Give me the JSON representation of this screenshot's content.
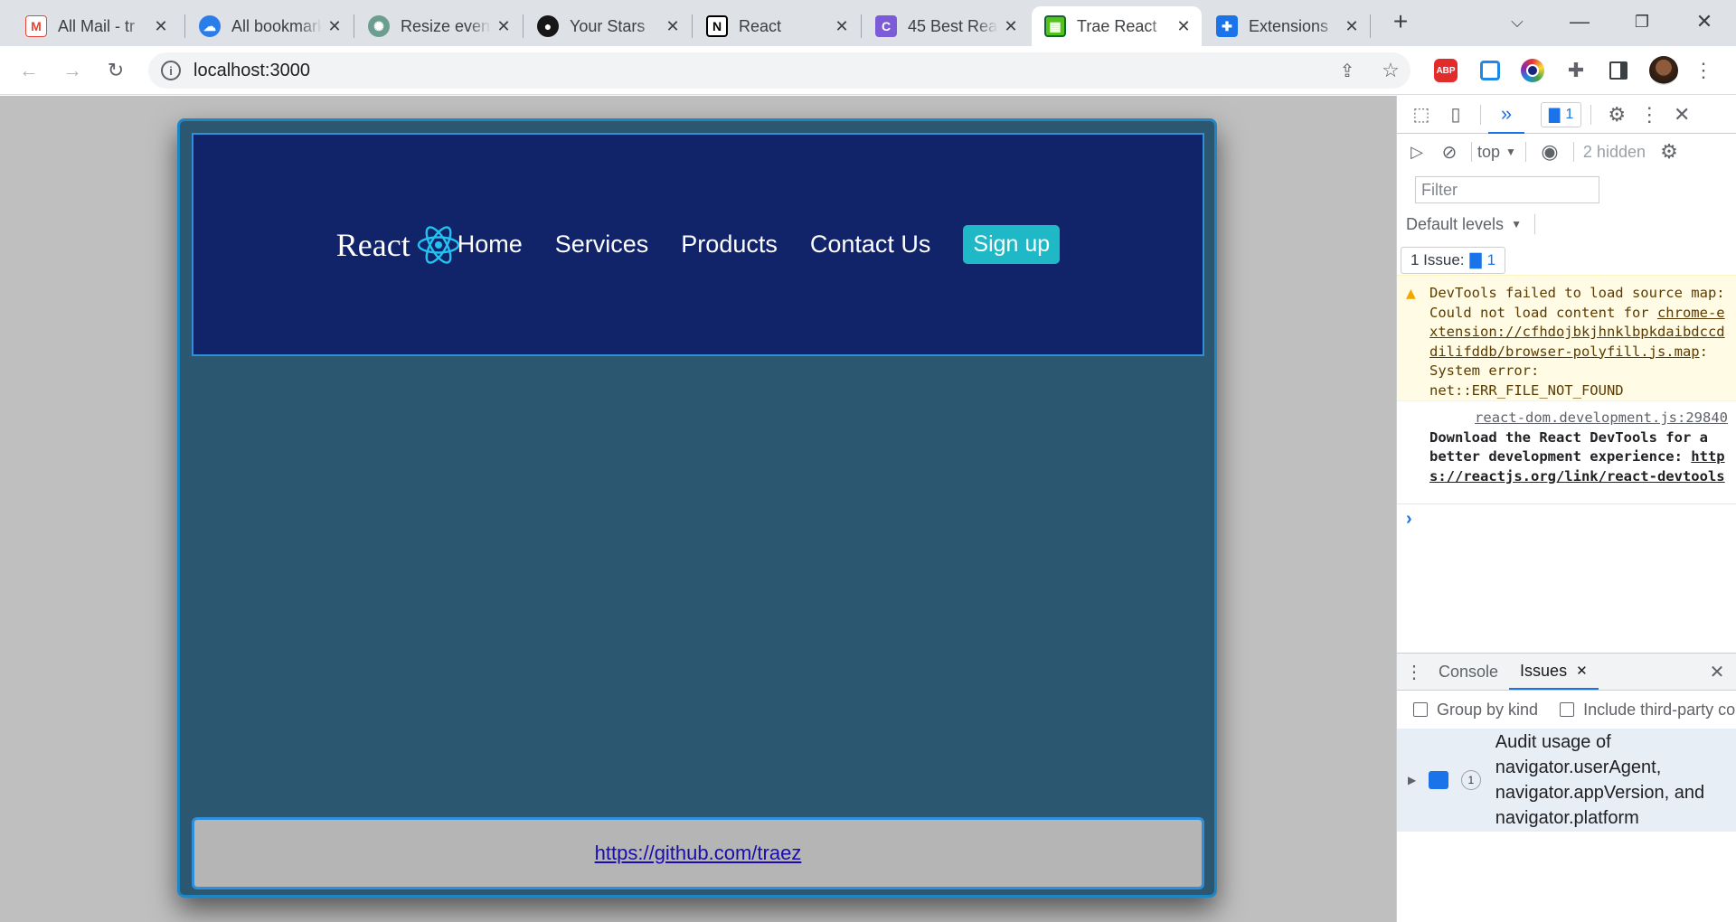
{
  "browser": {
    "tabs": [
      {
        "title": "All Mail - tr",
        "favicon": "gmail-icon",
        "color": "#ea4335",
        "active": false
      },
      {
        "title": "All bookmarks",
        "favicon": "cloud-icon",
        "color": "#2b7de9",
        "active": false
      },
      {
        "title": "Resize even",
        "favicon": "openai-icon",
        "color": "#6b9e8f",
        "active": false
      },
      {
        "title": "Your Stars",
        "favicon": "github-icon",
        "color": "#181717",
        "active": false
      },
      {
        "title": "React",
        "favicon": "notion-icon",
        "color": "#000000",
        "active": false
      },
      {
        "title": "45 Best Rea",
        "favicon": "c-icon",
        "color": "#7c5cd6",
        "active": false
      },
      {
        "title": "Trae React",
        "favicon": "trae-icon",
        "color": "#55c21b",
        "active": true
      },
      {
        "title": "Extensions",
        "favicon": "puzzle-icon",
        "color": "#1a73e8",
        "active": false
      }
    ],
    "new_tab_symbol": "+",
    "url": "localhost:3000"
  },
  "app": {
    "brand": "React",
    "nav": [
      "Home",
      "Services",
      "Products",
      "Contact Us"
    ],
    "signup": "Sign up",
    "footer_link": "https://github.com/traez",
    "colors": {
      "nav_bg": "#112369",
      "body_bg": "#2b5870",
      "accent": "#1fb8c7",
      "border": "#2f8fdc"
    }
  },
  "devtools": {
    "issues_badge": "1",
    "context": "top",
    "hidden": "2 hidden",
    "filter_placeholder": "Filter",
    "levels": "Default levels",
    "issue_chip_label": "1 Issue:",
    "issue_chip_count": "1",
    "warning": {
      "pre": "DevTools failed to load source map: Could not load content for ",
      "link": "chrome-extension://cfhdojbkjhnklbpkdaibdccddilifddb/browser-polyfill.js.map",
      "post": ": System error: net::ERR_FILE_NOT_FOUND"
    },
    "info": {
      "source": "react-dom.development.js:29840",
      "text": "Download the React DevTools for a better development experience: ",
      "link": "https://reactjs.org/link/react-devtools"
    },
    "prompt": "›",
    "drawer": {
      "tabs": [
        "Console",
        "Issues"
      ],
      "group_by_kind": "Group by kind",
      "include_third_party": "Include third-party co",
      "issue_count": "1",
      "issue_text": "Audit usage of navigator.userAgent, navigator.appVersion, and navigator.platform"
    }
  }
}
